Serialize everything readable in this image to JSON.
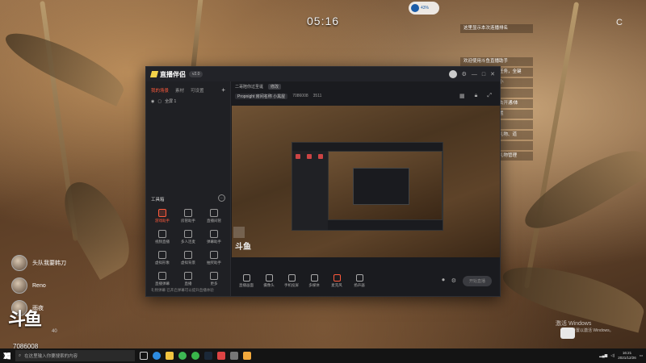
{
  "clock": "05:16",
  "top_widget": "43%",
  "moon": "C",
  "notifications": [
    "这里显示本次连播排名",
    "欢迎使用斗鱼直播助手",
    "全键拓展互联游戏任务，全键",
    "组体可调整文本大小",
    "右上角有设置菜单",
    "这里显示搜索，点击开通/体",
    "验，私信等详情设置",
    "请拉拽操作移动",
    "这里显示你收到的礼物、道",
    "具",
    "点击鼠标右键显示礼物管理"
  ],
  "app": {
    "name": "直播伴侣",
    "version": "v2.0",
    "side_tabs": [
      "我的场景",
      "素材",
      "可设置"
    ],
    "scene": "全屏 1",
    "tools_title": "工具箱",
    "tools": [
      {
        "label": "游戏助手",
        "active": true
      },
      {
        "label": "房管助手",
        "active": false
      },
      {
        "label": "直播间管",
        "active": false
      },
      {
        "label": "视频直播",
        "active": false
      },
      {
        "label": "多人连麦",
        "active": false
      },
      {
        "label": "弹幕助手",
        "active": false
      },
      {
        "label": "虚拟形象",
        "active": false
      },
      {
        "label": "虚拟背景",
        "active": false
      },
      {
        "label": "抽奖助手",
        "active": false
      },
      {
        "label": "直播弹幕",
        "active": false
      },
      {
        "label": "直播",
        "active": false
      },
      {
        "label": "更多",
        "active": false
      }
    ],
    "side_footer": "礼物弹幕  已开启弹幕可以提升直播体验",
    "room_title": "二哥陪你过圣诞",
    "room_tag": "修改",
    "room_category": "Propnight  房间名称  小黑屋",
    "room_number": "7086008",
    "online": "3511",
    "controls": [
      "直播画面",
      "摄像头",
      "手机投屏",
      "多媒体",
      "麦克风",
      "扬声器"
    ],
    "start_label": "开始直播",
    "status_line": "CPU 帧率 码率"
  },
  "viewers": [
    {
      "name": "头队我要韩刀"
    },
    {
      "name": "Reno"
    },
    {
      "name": "雨夜"
    }
  ],
  "brand": "斗鱼",
  "brand_sub": "40",
  "room_id": "7086008",
  "activate_title": "激活 Windows",
  "activate_sub": "转到设置以激活 Windows。",
  "taskbar": {
    "search_placeholder": "在这里输入你要搜索的内容",
    "time": "16:21",
    "date": "2021/12/26"
  }
}
